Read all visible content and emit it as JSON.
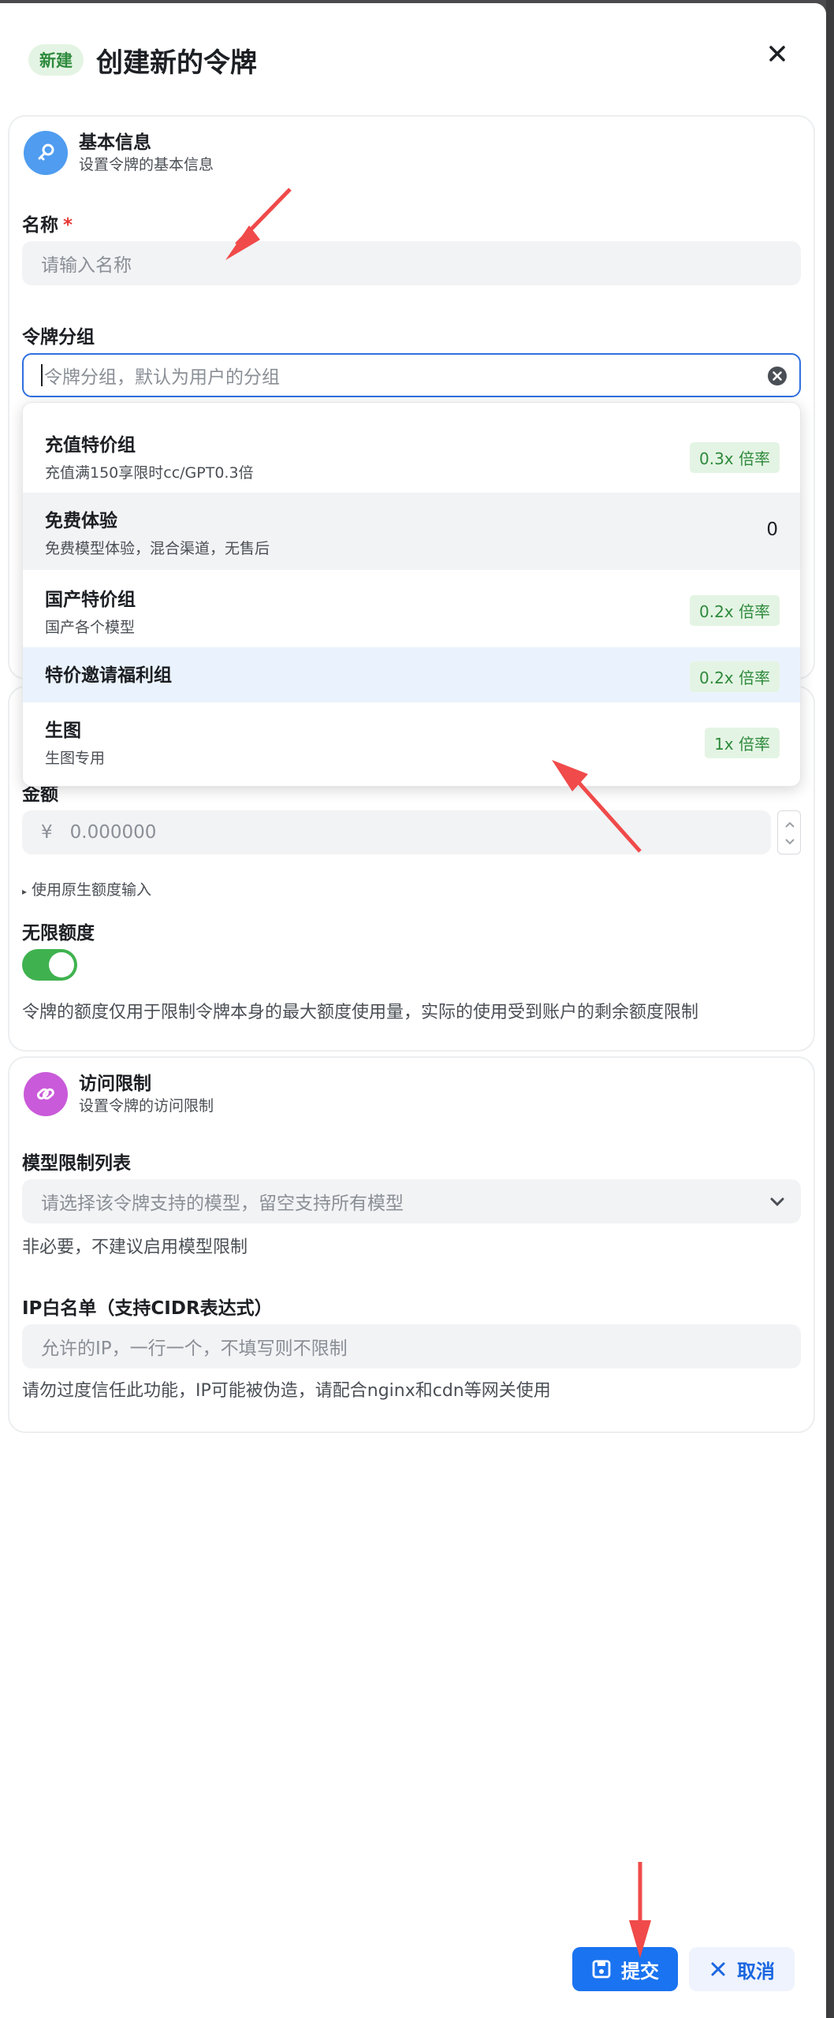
{
  "header": {
    "badge": "新建",
    "title": "创建新的令牌"
  },
  "basic": {
    "title": "基本信息",
    "subtitle": "设置令牌的基本信息",
    "name_label": "名称",
    "name_required_mark": "*",
    "name_placeholder": "请输入名称",
    "group_label": "令牌分组",
    "group_placeholder": "令牌分组，默认为用户的分组"
  },
  "group_options": [
    {
      "name": "充值特价组",
      "desc": "充值满150享限时cc/GPT0.3倍",
      "ratio": "0.3x 倍率"
    },
    {
      "name": "免费体验",
      "desc": "免费模型体验，混合渠道，无售后",
      "ratio": "0"
    },
    {
      "name": "国产特价组",
      "desc": "国产各个模型",
      "ratio": "0.2x 倍率"
    },
    {
      "name": "特价邀请福利组",
      "desc": "",
      "ratio": "0.2x 倍率"
    },
    {
      "name": "生图",
      "desc": "生图专用",
      "ratio": "1x 倍率"
    }
  ],
  "quota": {
    "amount_label": "金额",
    "currency_prefix": "¥",
    "amount_value": "0.000000",
    "raw_input_link": "使用原生额度输入",
    "unlimited_label": "无限额度",
    "unlimited_on": true,
    "help": "令牌的额度仅用于限制令牌本身的最大额度使用量，实际的使用受到账户的剩余额度限制"
  },
  "access": {
    "title": "访问限制",
    "subtitle": "设置令牌的访问限制",
    "models_label": "模型限制列表",
    "models_placeholder": "请选择该令牌支持的模型，留空支持所有模型",
    "models_help": "非必要，不建议启用模型限制",
    "ip_label": "IP白名单（支持CIDR表达式）",
    "ip_placeholder": "允许的IP，一行一个，不填写则不限制",
    "ip_help": "请勿过度信任此功能，IP可能被伪造，请配合nginx和cdn等网关使用"
  },
  "footer": {
    "submit": "提交",
    "cancel": "取消"
  },
  "colors": {
    "primary": "#1a73f0",
    "success": "#3fb24f",
    "annotation": "#f04a4a"
  }
}
